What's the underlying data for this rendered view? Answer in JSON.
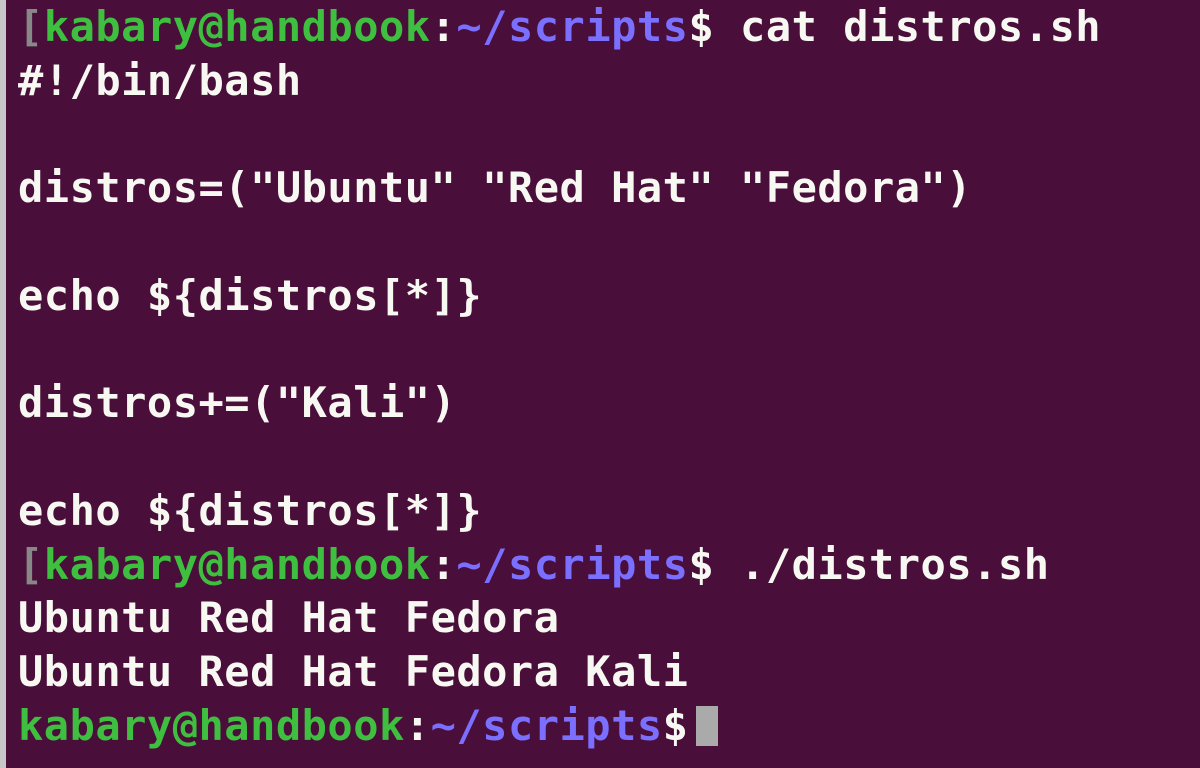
{
  "prompt": {
    "bracket_open": "[",
    "user_host": "kabary@handbook",
    "colon": ":",
    "path": "~/scripts",
    "dollar": "$"
  },
  "lines": {
    "cmd1": " cat distros.sh",
    "out1": "#!/bin/bash",
    "out2": "",
    "out3": "distros=(\"Ubuntu\" \"Red Hat\" \"Fedora\")",
    "out4": "",
    "out5": "echo ${distros[*]}",
    "out6": "",
    "out7": "distros+=(\"Kali\")",
    "out8": "",
    "out9": "echo ${distros[*]}",
    "cmd2": " ./distros.sh",
    "out10": "Ubuntu Red Hat Fedora",
    "out11": "Ubuntu Red Hat Fedora Kali"
  }
}
